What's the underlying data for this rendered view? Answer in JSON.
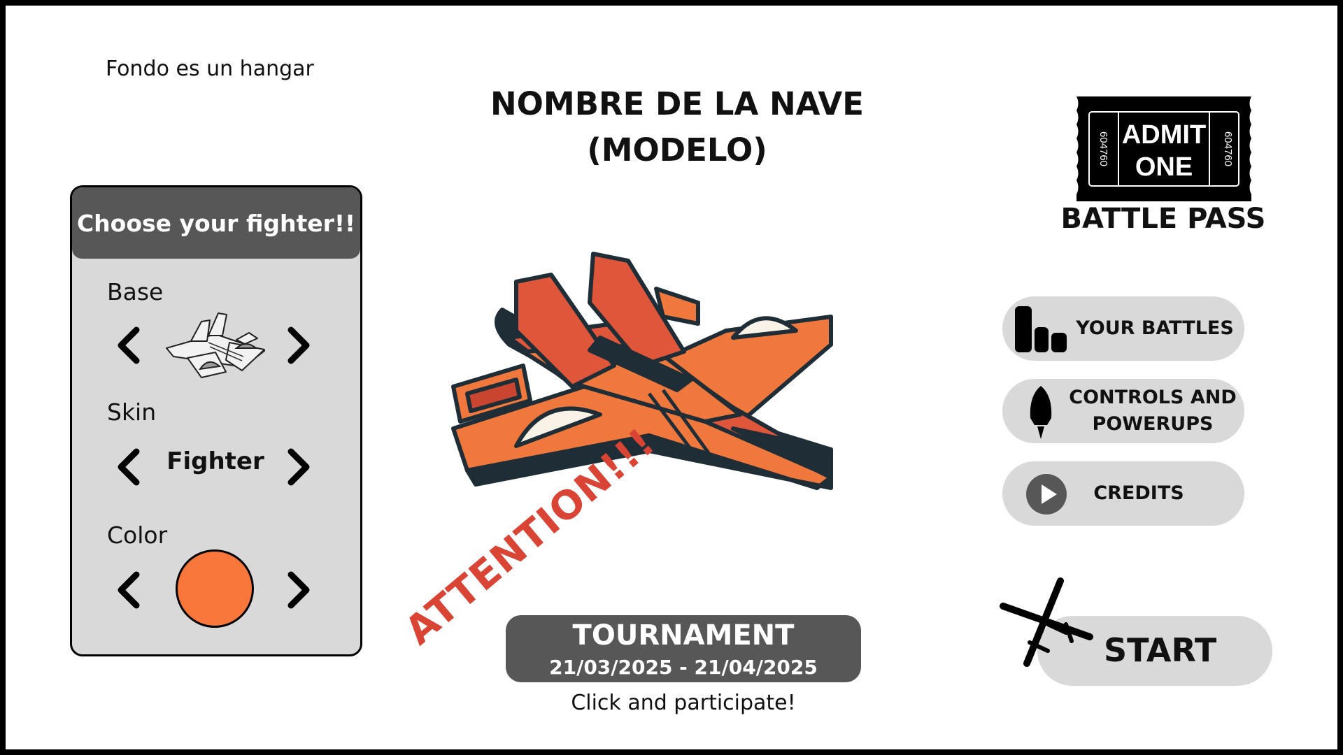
{
  "note": "Fondo es un hangar",
  "ship_title": {
    "line1": "NOMBRE DE LA NAVE",
    "line2": "(MODELO)"
  },
  "panel": {
    "title": "Choose your fighter!!",
    "base_label": "Base",
    "skin_label": "Skin",
    "skin_value": "Fighter",
    "color_label": "Color",
    "color_value": "#f9773a"
  },
  "battle_pass": {
    "ticket_line1": "ADMIT",
    "ticket_line2": "ONE",
    "ticket_serial": "604760",
    "label": "BATTLE PASS"
  },
  "menu": {
    "your_battles": "YOUR BATTLES",
    "controls_line1": "CONTROLS AND",
    "controls_line2": "POWERUPS",
    "credits": "CREDITS"
  },
  "tournament": {
    "title": "TOURNAMENT",
    "dates": "21/03/2025 - 21/04/2025",
    "cta": "Click and participate!",
    "banner": "ATTENTION!!!"
  },
  "start_label": "START",
  "colors": {
    "accent_orange": "#f9773a",
    "ship_red": "#e0563a",
    "dark_gray": "#575757",
    "light_gray": "#d9d9d9"
  }
}
